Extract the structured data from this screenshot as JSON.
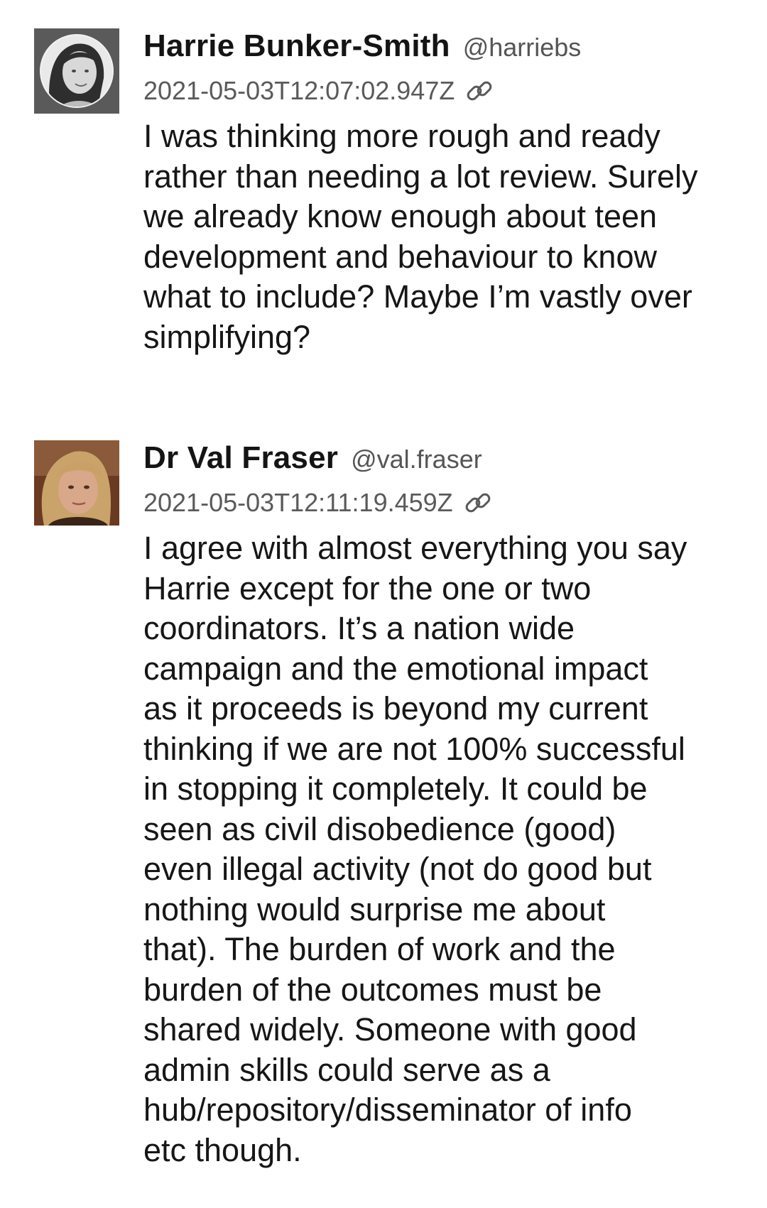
{
  "posts": [
    {
      "author": "Harrie Bunker-Smith",
      "handle": "@harriebs",
      "timestamp": "2021-05-03T12:07:02.947Z",
      "avatar_icon": "avatar-photo-harrie",
      "link_icon": "link-icon",
      "body_lines": [
        "I was thinking more rough and ready",
        "rather than needing a lot review. Surely",
        "we already know enough about teen",
        "development and behaviour to know",
        "what to include? Maybe I’m vastly over",
        "simplifying?"
      ]
    },
    {
      "author": "Dr Val Fraser",
      "handle": "@val.fraser",
      "timestamp": "2021-05-03T12:11:19.459Z",
      "avatar_icon": "avatar-photo-val",
      "link_icon": "link-icon",
      "body_lines": [
        "I agree with almost everything you say",
        "Harrie except for the one or two",
        "coordinators. It’s a nation wide",
        "campaign and the emotional impact",
        "as it proceeds is beyond my current",
        "thinking if we are not 100% successful",
        "in stopping it completely. It could be",
        "seen as civil disobedience (good)",
        "even illegal activity (not do good but",
        "nothing would surprise me about",
        "that). The burden of work and the",
        "burden of the outcomes must be",
        "shared widely. Someone with good",
        "admin skills could serve as a",
        "hub/repository/disseminator of info",
        "etc though."
      ]
    }
  ]
}
